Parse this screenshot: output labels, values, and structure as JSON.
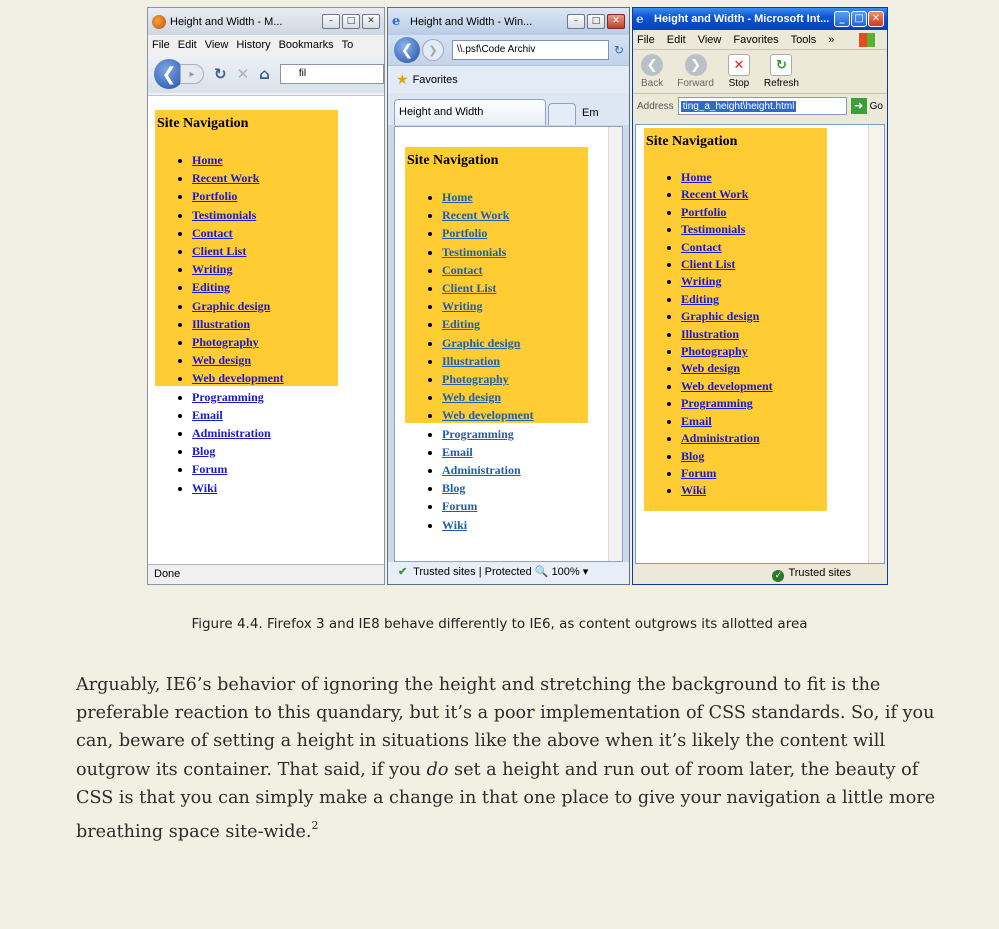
{
  "nav_links": [
    "Home",
    "Recent Work",
    "Portfolio",
    "Testimonials",
    "Contact",
    "Client List",
    "Writing",
    "Editing",
    "Graphic design",
    "Illustration",
    "Photography",
    "Web design",
    "Web development",
    "Programming",
    "Email",
    "Administration",
    "Blog",
    "Forum",
    "Wiki"
  ],
  "nav_heading": "Site Navigation",
  "firefox": {
    "title": "Height and Width - M...",
    "menus": [
      "File",
      "Edit",
      "View",
      "History",
      "Bookmarks",
      "To"
    ],
    "url": "fil",
    "status": "Done"
  },
  "ie8": {
    "title": "Height and Width - Win...",
    "address": "\\\\.psf\\Code Archiv",
    "favorites": "Favorites",
    "tab": "Height and Width",
    "tab2": "Em",
    "status": "Trusted sites | Protected",
    "zoom": "100%"
  },
  "ie6": {
    "title": "Height and Width - Microsoft Int...",
    "menus": [
      "File",
      "Edit",
      "View",
      "Favorites",
      "Tools"
    ],
    "toolbar": [
      "Back",
      "Forward",
      "Stop",
      "Refresh"
    ],
    "address_label": "Address",
    "address": "ting_a_height\\height.html",
    "go": "Go",
    "status": "Trusted sites"
  },
  "caption": "Figure 4.4. Firefox 3 and IE8 behave differently to IE6, as content outgrows its allotted area",
  "paragraph": {
    "part1": "Arguably, IE6’s behavior of ignoring the height and stretching the background to fit is the preferable reaction to this quandary, but it’s a poor implementation of CSS standards. So, if you can, beware of setting a height in situations like the above when it’s likely the content will outgrow its container. That said, if you ",
    "emphasis": "do",
    "part2": " set a height and run out of room later, the beauty of CSS is that you can simply make a change in that one place to give your navigation a little more breathing space site-wide.",
    "footnote": "2"
  }
}
